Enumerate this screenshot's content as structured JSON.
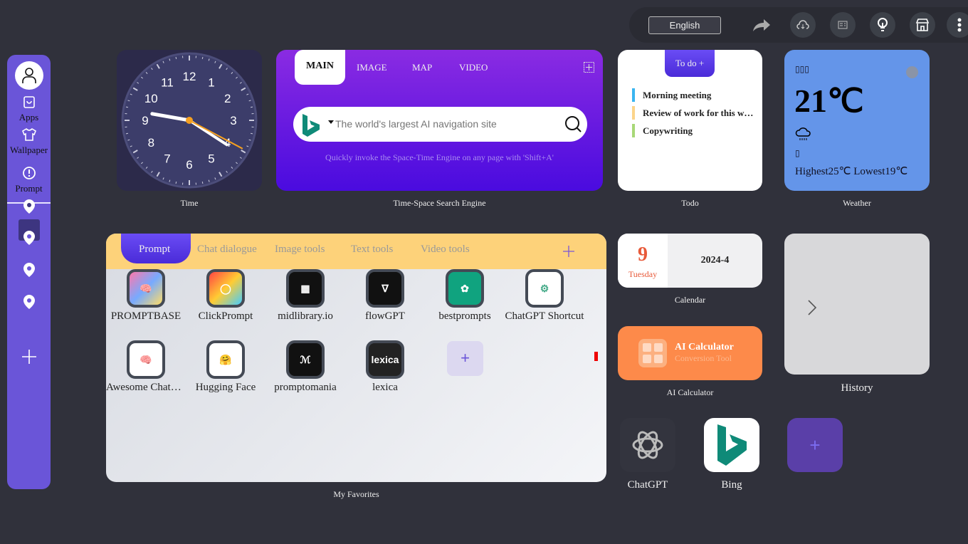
{
  "topbar": {
    "language": "English",
    "icons": [
      "share-icon",
      "cloud-download-icon",
      "news-icon",
      "lightbulb-icon",
      "store-icon",
      "more-icon"
    ]
  },
  "sidebar": {
    "items": [
      {
        "label": "Apps",
        "icon": "bag-icon"
      },
      {
        "label": "Wallpaper",
        "icon": "shirt-icon"
      },
      {
        "label": "Prompt",
        "icon": "alert-circle-icon"
      }
    ]
  },
  "clock": {
    "caption": "Time",
    "numbers": [
      "12",
      "1",
      "2",
      "3",
      "4",
      "5",
      "6",
      "7",
      "8",
      "9",
      "10",
      "11"
    ]
  },
  "search": {
    "tabs": [
      "MAIN",
      "IMAGE",
      "MAP",
      "VIDEO"
    ],
    "placeholder": "The world's largest AI navigation site",
    "hint": "Quickly invoke the Space-Time Engine on any page with 'Shift+A'",
    "caption": "Time-Space Search Engine",
    "engine": "Bing"
  },
  "todo": {
    "header": "To do +",
    "items": [
      {
        "text": "Morning meeting",
        "color": "#3ab5f0"
      },
      {
        "text": "Review of work for this w…",
        "color": "#fcd48a"
      },
      {
        "text": "Copywriting",
        "color": "#a8d878"
      }
    ],
    "caption": "Todo"
  },
  "weather": {
    "location": "▯▯▯",
    "temp": "21℃",
    "cond": "▯",
    "range": "Highest25℃ Lowest19℃",
    "caption": "Weather"
  },
  "favorites": {
    "tabs": [
      "Prompt",
      "Chat dialogue",
      "Image tools",
      "Text tools",
      "Video tools"
    ],
    "apps": [
      "PROMPTBASE",
      "ClickPrompt",
      "midlibrary.io",
      "flowGPT",
      "bestprompts",
      "ChatGPT Shortcut",
      "Awesome ChatG…",
      "Hugging Face",
      "promptomania",
      "lexica"
    ],
    "caption": "My Favorites"
  },
  "calendar": {
    "day": "9",
    "weekday": "Tuesday",
    "month": "2024-4",
    "caption": "Calendar"
  },
  "calc": {
    "title": "AI Calculator",
    "sub": "Conversion Tool",
    "caption": "AI Calculator"
  },
  "history": {
    "caption": "History"
  },
  "shortcuts": [
    {
      "label": "ChatGPT"
    },
    {
      "label": "Bing"
    }
  ]
}
